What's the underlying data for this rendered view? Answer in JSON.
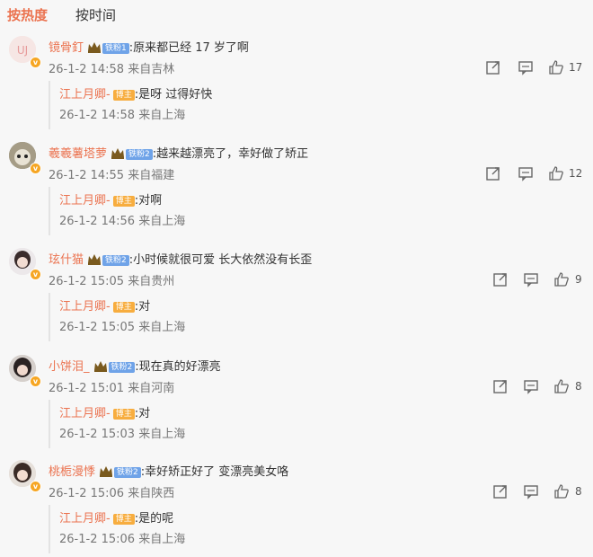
{
  "tabs": {
    "hot": "按热度",
    "time": "按时间"
  },
  "colors": {
    "accent": "#eb7350",
    "fan_badge": "#6fa3e8",
    "host_badge": "#f7ad3f"
  },
  "comments": [
    {
      "user": "镜骨釘",
      "fan_badge": "铁粉1",
      "text": ":原来都已经 17 岁了啊",
      "time": "26-1-2 14:58",
      "location": "来自吉林",
      "likes": "17",
      "reply": {
        "user": "江上月卿-",
        "badge": "博主",
        "text": ":是呀 过得好快",
        "time": "26-1-2 14:58",
        "location": "来自上海"
      }
    },
    {
      "user": "羲羲薯塔萝",
      "fan_badge": "铁粉2",
      "text": ":越来越漂亮了，幸好做了矫正",
      "time": "26-1-2 14:55",
      "location": "来自福建",
      "likes": "12",
      "reply": {
        "user": "江上月卿-",
        "badge": "博主",
        "text": ":对啊",
        "time": "26-1-2 14:56",
        "location": "来自上海"
      }
    },
    {
      "user": "玹什猫",
      "fan_badge": "铁粉2",
      "text": ":小时候就很可爱 长大依然没有长歪",
      "time": "26-1-2 15:05",
      "location": "来自贵州",
      "likes": "9",
      "reply": {
        "user": "江上月卿-",
        "badge": "博主",
        "text": ":对",
        "time": "26-1-2 15:05",
        "location": "来自上海"
      }
    },
    {
      "user": "小饼泪_",
      "fan_badge": "铁粉2",
      "text": ":现在真的好漂亮",
      "time": "26-1-2 15:01",
      "location": "来自河南",
      "likes": "8",
      "reply": {
        "user": "江上月卿-",
        "badge": "博主",
        "text": ":对",
        "time": "26-1-2 15:03",
        "location": "来自上海"
      }
    },
    {
      "user": "桃栀漫悸",
      "fan_badge": "铁粉2",
      "text": ":幸好矫正好了 变漂亮美女咯",
      "time": "26-1-2 15:06",
      "location": "来自陕西",
      "likes": "8",
      "reply": {
        "user": "江上月卿-",
        "badge": "博主",
        "text": ":是的呢",
        "time": "26-1-2 15:06",
        "location": "来自上海"
      }
    }
  ]
}
